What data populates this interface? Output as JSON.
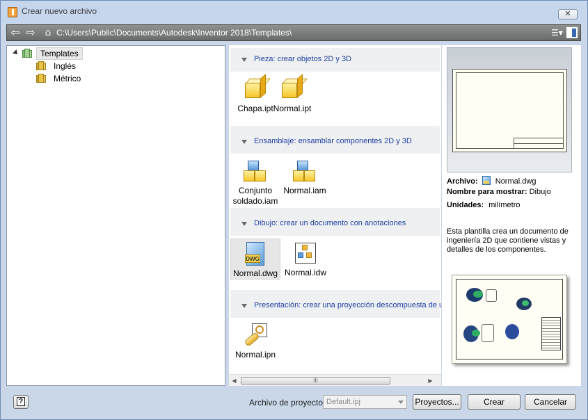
{
  "window": {
    "title": "Crear nuevo archivo",
    "close_label": "✕"
  },
  "addressbar": {
    "path": "C:\\Users\\Public\\Documents\\Autodesk\\Inventor 2018\\Templates\\"
  },
  "tree": {
    "root": "Templates",
    "children": [
      "Inglés",
      "Métrico"
    ]
  },
  "sections": [
    {
      "title": "Pieza: crear objetos 2D y 3D",
      "files": [
        "Chapa.ipt",
        "Normal.ipt"
      ]
    },
    {
      "title": "Ensamblaje: ensamblar componentes 2D y 3D",
      "files": [
        "Conjunto soldado.iam",
        "Normal.iam"
      ]
    },
    {
      "title": "Dibujo: crear un documento con anotaciones",
      "files": [
        "Normal.dwg",
        "Normal.idw"
      ]
    },
    {
      "title": "Presentación: crear una proyección descompuesta de ur",
      "files": [
        "Normal.ipn"
      ]
    }
  ],
  "scrollbar": {
    "thumb_label": "III",
    "left_arrow": "◀",
    "right_arrow": "▶"
  },
  "preview": {
    "archivo_label": "Archivo:",
    "archivo_value": "Normal.dwg",
    "nombre_label": "Nombre para mostrar:",
    "nombre_value": "Dibujo",
    "unidades_label": "Unidades:",
    "unidades_value": "milímetro",
    "description": "Esta plantilla crea un documento de ingeniería 2D que contiene vistas y detalles de los componentes."
  },
  "footer": {
    "project_label": "Archivo de proyecto:",
    "project_value": "Default.ipj",
    "projects_button": "Proyectos...",
    "create_button": "Crear",
    "cancel_button": "Cancelar"
  },
  "colors": {
    "section_title": "#1f3fa0",
    "addressbar": "#6a6b6b"
  },
  "icons": {
    "back": "arrow-left-icon",
    "forward": "arrow-right-icon",
    "home": "home-icon",
    "help": "help-icon",
    "folder": "folder-icon"
  }
}
